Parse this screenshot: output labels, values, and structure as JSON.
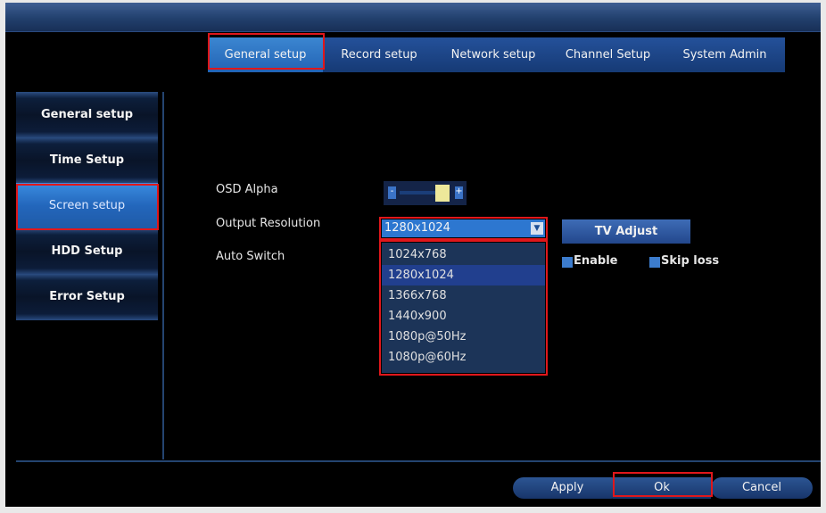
{
  "tabs": [
    {
      "label": "General setup",
      "active": true
    },
    {
      "label": "Record setup",
      "active": false
    },
    {
      "label": "Network setup",
      "active": false
    },
    {
      "label": "Channel Setup",
      "active": false
    },
    {
      "label": "System Admin",
      "active": false
    }
  ],
  "sidebar": {
    "items": [
      {
        "label": "General setup",
        "active": false
      },
      {
        "label": "Time Setup",
        "active": false
      },
      {
        "label": "Screen setup",
        "active": true
      },
      {
        "label": "HDD Setup",
        "active": false
      },
      {
        "label": "Error Setup",
        "active": false
      }
    ]
  },
  "form": {
    "osd_alpha_label": "OSD Alpha",
    "osd_alpha_minus": "-",
    "osd_alpha_plus": "+",
    "output_resolution_label": "Output Resolution",
    "output_resolution_value": "1280x1024",
    "resolution_options": [
      "1024x768",
      "1280x1024",
      "1366x768",
      "1440x900",
      "1080p@50Hz",
      "1080p@60Hz"
    ],
    "resolution_selected": "1280x1024",
    "auto_switch_label": "Auto Switch",
    "tv_adjust_label": "TV Adjust",
    "enable_label": "Enable",
    "skip_loss_label": "Skip loss"
  },
  "footer": {
    "apply_label": "Apply",
    "ok_label": "Ok",
    "cancel_label": "Cancel"
  },
  "colors": {
    "highlight_box": "#e0171b",
    "active_blue": "#2d77d0",
    "panel_background": "#000000"
  }
}
